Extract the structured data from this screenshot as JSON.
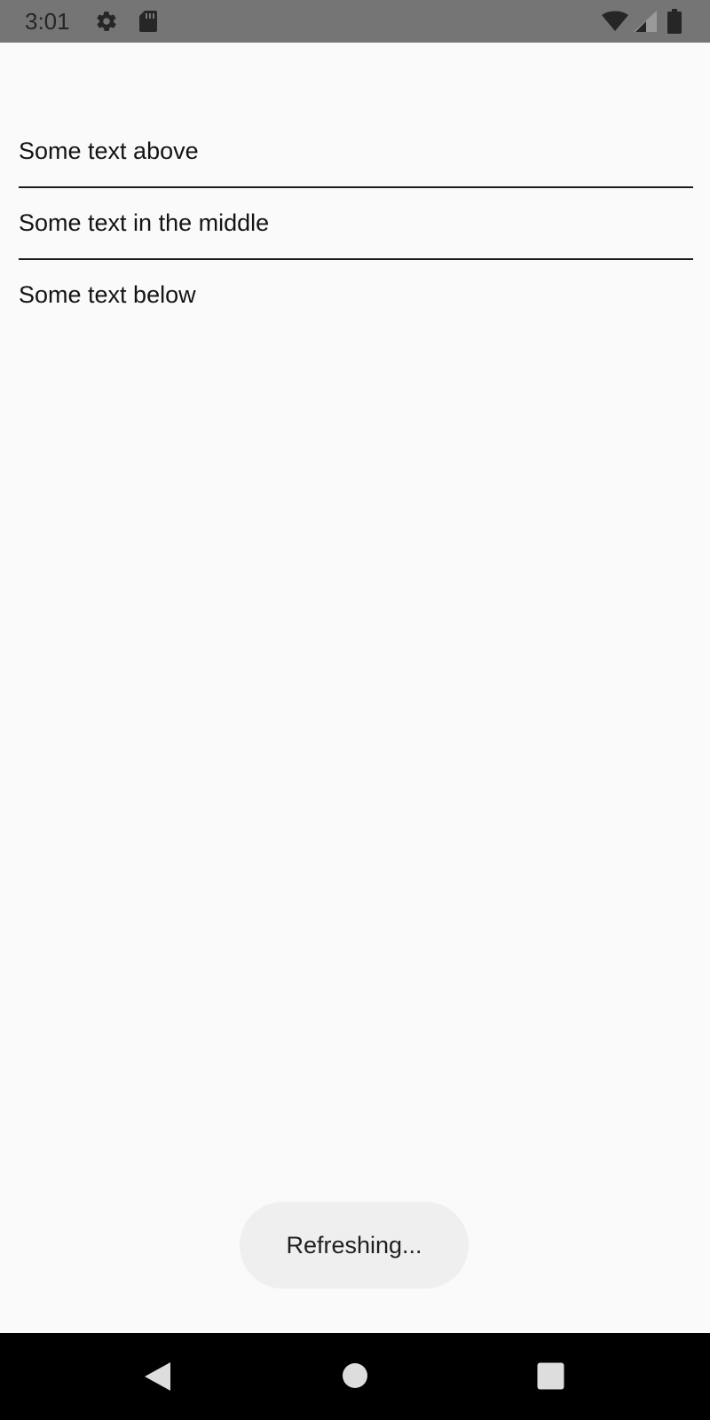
{
  "status_bar": {
    "time": "3:01",
    "icons": [
      "gear-icon",
      "sd-card-icon",
      "wifi-icon",
      "signal-icon",
      "battery-icon"
    ]
  },
  "content": {
    "rows": [
      {
        "text": "Some text above"
      },
      {
        "text": "Some text in the middle"
      },
      {
        "text": "Some text below"
      }
    ]
  },
  "toast": {
    "text": "Refreshing..."
  },
  "nav_bar": {
    "buttons": [
      "back-icon",
      "home-icon",
      "recents-icon"
    ]
  },
  "colors": {
    "background": "#fafafa",
    "status_bar": "#757575",
    "nav_bar": "#000000",
    "toast_bg": "#efefef",
    "divider": "#1c1c1c"
  }
}
